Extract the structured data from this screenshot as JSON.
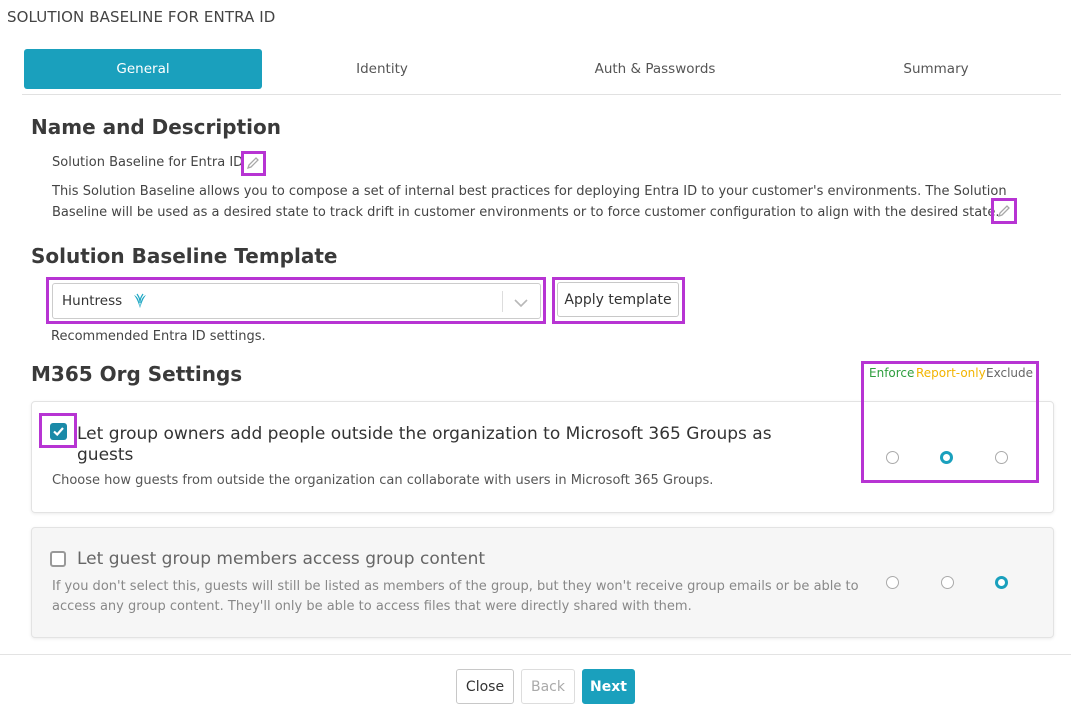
{
  "page": {
    "title": "SOLUTION BASELINE FOR ENTRA ID"
  },
  "tabs": [
    {
      "label": "General",
      "active": true
    },
    {
      "label": "Identity"
    },
    {
      "label": "Auth & Passwords"
    },
    {
      "label": "Summary"
    }
  ],
  "name_section": {
    "heading": "Name and Description",
    "name": "Solution Baseline for Entra ID",
    "description_line1": "This Solution Baseline allows you to compose a set of internal best practices for deploying Entra ID to your customer's environments. The Solution",
    "description_line2": "Baseline will be used as a desired state to track drift in customer environments or to force customer configuration to align with the desired state."
  },
  "template_section": {
    "heading": "Solution Baseline Template",
    "selected": "Huntress",
    "apply_label": "Apply template",
    "note": "Recommended Entra ID settings."
  },
  "org_settings": {
    "heading": "M365 Org Settings",
    "legend": {
      "enforce": "Enforce",
      "report_only": "Report-only",
      "exclude": "Exclude",
      "enforce_color": "#2e9e3e",
      "report_only_color": "#f2b400",
      "exclude_color": "#666666"
    },
    "settings": [
      {
        "title_line1": "Let group owners add people outside the organization to Microsoft 365 Groups as",
        "title_line2": "guests",
        "description_line1": "Choose how guests from outside the organization can collaborate with users in Microsoft 365 Groups.",
        "checked": true,
        "mode": "report-only"
      },
      {
        "title_line1": "Let guest group members access group content",
        "description_line1": "If you don't select this, guests will still be listed as members of the group, but they won't receive group emails or be able to",
        "description_line2": "access any group content. They'll only be able to access files that were directly shared with them.",
        "checked": false,
        "mode": "exclude"
      }
    ]
  },
  "footer": {
    "close_label": "Close",
    "back_label": "Back",
    "next_label": "Next"
  },
  "colors": {
    "accent": "#1aa0bd",
    "highlight": "#b734d3"
  }
}
